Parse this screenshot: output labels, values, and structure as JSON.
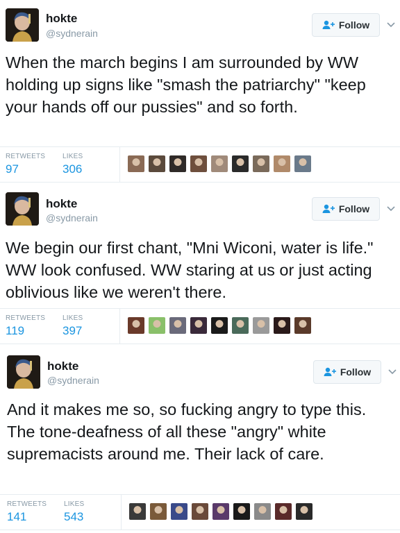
{
  "tweets": [
    {
      "name": "hokte",
      "handle": "@sydnerain",
      "follow_label": "Follow",
      "text": "When the march begins I am surrounded by WW holding up signs like \"smash the patriarchy\" \"keep your hands off our pussies\" and so forth.",
      "retweets_label": "RETWEETS",
      "retweets": "97",
      "likes_label": "LIKES",
      "likes": "306",
      "liker_colors": [
        "#8a6a55",
        "#5b4a3c",
        "#2f2a28",
        "#6e4f3d",
        "#a08a7a",
        "#2a2a2a",
        "#7a6a5a",
        "#b08a6a",
        "#6a7a8a"
      ]
    },
    {
      "name": "hokte",
      "handle": "@sydnerain",
      "follow_label": "Follow",
      "text": "We begin our first chant, \"Mni Wiconi, water is life.\" WW look confused. WW staring at us or just acting oblivious like we weren't there.",
      "retweets_label": "RETWEETS",
      "retweets": "119",
      "likes_label": "LIKES",
      "likes": "397",
      "liker_colors": [
        "#6a3a2a",
        "#8ac06a",
        "#6a6a7a",
        "#3a2a3a",
        "#1a1a1a",
        "#4a6a5a",
        "#9a9a9a",
        "#2a1a1a",
        "#5a3a2a"
      ]
    },
    {
      "name": "hokte",
      "handle": "@sydnerain",
      "follow_label": "Follow",
      "text": "And it makes me so, so fucking angry to type this. The tone-deafness of all these \"angry\" white supremacists around me. Their lack of care.",
      "retweets_label": "RETWEETS",
      "retweets": "141",
      "likes_label": "LIKES",
      "likes": "543",
      "liker_colors": [
        "#3a3a3a",
        "#7a5a3a",
        "#3a4a8a",
        "#6a4a3a",
        "#5a3a6a",
        "#1a1a1a",
        "#8a8a8a",
        "#5a2a2a",
        "#2a2a2a"
      ]
    }
  ]
}
